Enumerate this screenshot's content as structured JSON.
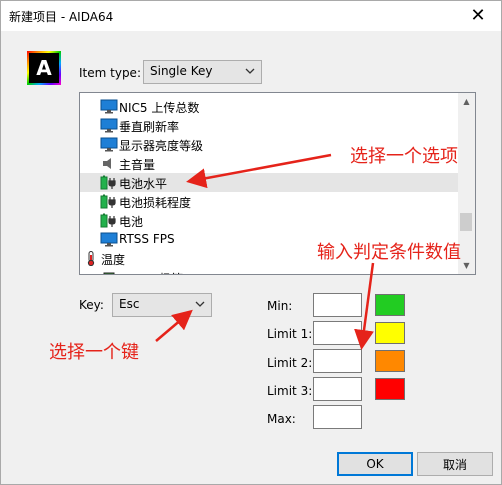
{
  "window": {
    "title": "新建项目 - AIDA64",
    "close_glyph": "✕"
  },
  "logo": {
    "letter": "A"
  },
  "item_type": {
    "label": "Item type:",
    "value": "Single Key"
  },
  "list": {
    "items": [
      {
        "label": "NIC5 上传总数",
        "icon": "monitor-icon"
      },
      {
        "label": "垂直刷新率",
        "icon": "monitor-icon"
      },
      {
        "label": "显示器亮度等级",
        "icon": "monitor-icon"
      },
      {
        "label": "主音量",
        "icon": "speaker-icon"
      },
      {
        "label": "电池水平",
        "icon": "battery-plug-icon",
        "selected": true
      },
      {
        "label": "电池损耗程度",
        "icon": "battery-plug-icon"
      },
      {
        "label": "电池",
        "icon": "battery-plug-icon"
      },
      {
        "label": "RTSS FPS",
        "icon": "monitor-icon"
      },
      {
        "label": "温度",
        "icon": "thermometer-icon",
        "category": true
      },
      {
        "label": "CPU 二极管",
        "icon": "chip-icon"
      }
    ]
  },
  "key": {
    "label": "Key:",
    "value": "Esc"
  },
  "thresholds": {
    "min_label": "Min:",
    "limit1_label": "Limit 1:",
    "limit2_label": "Limit 2:",
    "limit3_label": "Limit 3:",
    "max_label": "Max:",
    "colors": {
      "min": "#22cc22",
      "limit1": "#ffff00",
      "limit2": "#ff8800",
      "limit3": "#ff0000"
    }
  },
  "buttons": {
    "ok": "OK",
    "cancel": "取消"
  },
  "annotations": {
    "choose_option": "选择一个选项",
    "enter_values": "输入判定条件数值",
    "choose_key": "选择一个键",
    "color": "#e5231a"
  }
}
